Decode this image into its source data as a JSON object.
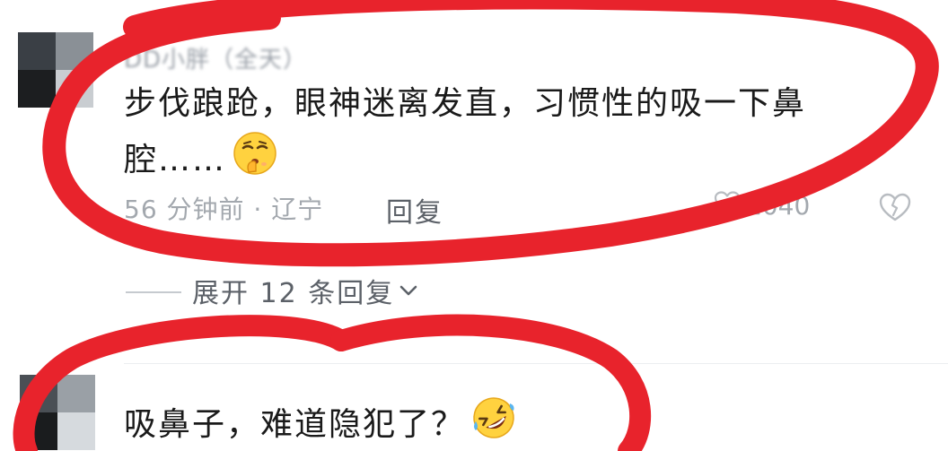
{
  "comments": [
    {
      "username": "DD小胖（全天）",
      "text": "步伐踉跄，眼神迷离发直，习惯性的吸一下鼻腔……",
      "emoji": "shushing-face",
      "time_location": "56 分钟前 · 辽宁",
      "reply_label": "回复",
      "likes": "1040"
    },
    {
      "text": "吸鼻子，难道隐犯了？",
      "emoji": "rolling-laughing-face"
    }
  ],
  "expand_replies": "展开 12 条回复",
  "colors": {
    "annotation_red": "#e8232c",
    "meta_gray": "#a3a8ae"
  },
  "icons": [
    "heart-outline-icon",
    "broken-heart-icon",
    "chevron-down-icon"
  ]
}
